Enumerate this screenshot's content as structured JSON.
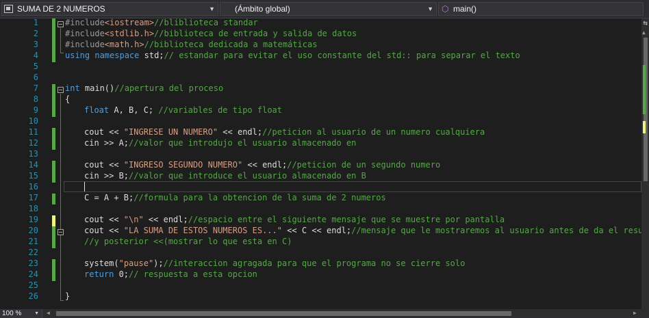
{
  "navbar": {
    "project": "SUMA DE 2 NUMEROS",
    "scope": "(Ámbito global)",
    "member": "main()"
  },
  "editor": {
    "line_numbers": [
      "1",
      "2",
      "3",
      "4",
      "5",
      "6",
      "7",
      "8",
      "9",
      "10",
      "11",
      "12",
      "13",
      "14",
      "15",
      "16",
      "17",
      "18",
      "19",
      "20",
      "21",
      "22",
      "23",
      "24",
      "25",
      "26"
    ],
    "lines": {
      "l1": {
        "kw": "#include",
        "tok": "<iostream>",
        "cmt": "//bliblioteca standar"
      },
      "l2": {
        "kw": "#include",
        "tok": "<stdlib.h>",
        "cmt": "//biblioteca de entrada y salida de datos"
      },
      "l3": {
        "kw": "#include",
        "tok": "<math.h>",
        "cmt": "//biblioteca dedicada a matemáticas"
      },
      "l4": {
        "kw1": "using",
        "kw2": "namespace",
        "txt": " std;",
        "cmt": "// estandar para evitar el uso constante del std:: para separar el texto"
      },
      "l8": {
        "kw": "int",
        "txt": " main()",
        "cmt": "//apertura del proceso"
      },
      "l9": {
        "txt": "{"
      },
      "l10": {
        "kw": "float",
        "txt": " A, B, C; ",
        "cmt": "//variables de tipo float"
      },
      "l12": {
        "txt1": "cout << ",
        "str": "\"INGRESE UN NUMERO\"",
        "txt2": " << endl;",
        "cmt": "//peticion al usuario de un numero cualquiera"
      },
      "l13": {
        "txt": "cin >> A;",
        "cmt": "//valor que introdujo el usuario almacenado en"
      },
      "l15": {
        "txt1": "cout << ",
        "str": "\"INGRESO SEGUNDO NUMERO\"",
        "txt2": " << endl;",
        "cmt": "//peticion de un segundo numero"
      },
      "l16": {
        "txt": "cin >> B;",
        "cmt": "//valor que introduce el usuario almacenado en B"
      },
      "l18": {
        "txt": "C = A + B;",
        "cmt": "//formula para la obtencion de la suma de 2 numeros"
      },
      "l20": {
        "txt1": "cout << ",
        "str": "\"\\n\"",
        "txt2": " << endl;",
        "cmt": "//espacio entre el siguiente mensaje que se muestre por pantalla"
      },
      "l21": {
        "txt1": "cout << ",
        "str": "\"LA SUMA DE ESTOS NUMEROS ES...\"",
        "txt2": " << C << endl;",
        "cmt": "//mensaje que le mostraremos al usuario antes de da el resultado"
      },
      "l22": {
        "cmt": "//y posterior <<(mostrar lo que esta en C)"
      },
      "l24": {
        "fn": "system",
        "txt1": "(",
        "str": "\"pause\"",
        "txt2": ");",
        "cmt": "//interaccion agragada para que el programa no se cierre solo"
      },
      "l25": {
        "kw": "return",
        "txt": " 0;",
        "cmt": "// respuesta a esta opcion"
      },
      "l27": {
        "txt": "}"
      }
    }
  },
  "statusbar": {
    "zoom": "100 %"
  },
  "colors": {
    "keyword": "#569cd6",
    "comment": "#57a64a",
    "string": "#d69d85",
    "include_target": "#d69d85",
    "line_number": "#2b91af",
    "saved_change": "#57a64a",
    "unsaved_change": "#eff284",
    "background": "#1e1e1e"
  }
}
